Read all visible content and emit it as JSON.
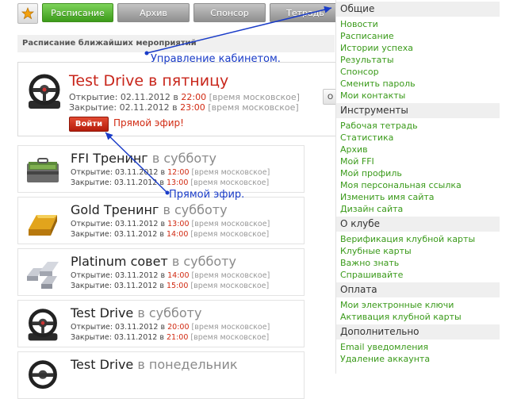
{
  "tabs": [
    {
      "label": "Расписание",
      "active": true
    },
    {
      "label": "Архив",
      "active": false
    },
    {
      "label": "Спонсор",
      "active": false
    },
    {
      "label": "Тетрадь",
      "active": false
    }
  ],
  "favorites_icon": "star-icon",
  "heading": "Расписание ближайших мероприятий",
  "featured": {
    "title": "Test Drive в пятницу",
    "open_label": "Открытие: 02.11.2012 в",
    "open_time": "22:00",
    "close_label": "Закрытие: 02.11.2012 в",
    "close_time": "23:00",
    "tz_note": "[время московское]",
    "enter_button": "Войти",
    "live_text": "Прямой эфир!"
  },
  "events": [
    {
      "name": "FFI Тренинг",
      "day": "в субботу",
      "open_label": "Открытие: 03.11.2012 в",
      "open_time": "12:00",
      "close_label": "Закрытие: 03.11.2012 в",
      "close_time": "13:00",
      "tz_note": "[время московское]",
      "icon": "cash-case-icon"
    },
    {
      "name": "Gold Тренинг",
      "day": "в субботу",
      "open_label": "Открытие: 03.11.2012 в",
      "open_time": "13:00",
      "close_label": "Закрытие: 03.11.2012 в",
      "close_time": "14:00",
      "tz_note": "[время московское]",
      "icon": "gold-bar-icon"
    },
    {
      "name": "Platinum совет",
      "day": "в субботу",
      "open_label": "Открытие: 03.11.2012 в",
      "open_time": "14:00",
      "close_label": "Закрытие: 03.11.2012 в",
      "close_time": "15:00",
      "tz_note": "[время московское]",
      "icon": "platinum-bars-icon"
    },
    {
      "name": "Test Drive",
      "day": "в субботу",
      "open_label": "Открытие: 03.11.2012 в",
      "open_time": "20:00",
      "close_label": "Закрытие: 03.11.2012 в",
      "close_time": "21:00",
      "tz_note": "[время московское]",
      "icon": "steering-wheel-icon"
    },
    {
      "name": "Test Drive",
      "day": "в понедельник",
      "icon": "steering-wheel-icon"
    }
  ],
  "sidebar": {
    "sections": [
      {
        "title": "Общие",
        "items": [
          "Новости",
          "Расписание",
          "Истории успеха",
          "Результаты",
          "Спонсор",
          "Сменить пароль",
          "Мои контакты"
        ]
      },
      {
        "title": "Инструменты",
        "items": [
          "Рабочая тетрадь",
          "Статистика",
          "Архив",
          "Мой FFI",
          "Мой профиль",
          "Моя персональная ссылка",
          "Изменить имя сайта",
          "Дизайн сайта"
        ]
      },
      {
        "title": "О клубе",
        "items": [
          "Верификация клубной карты",
          "Клубные карты",
          "Важно знать",
          "Спрашивайте"
        ]
      },
      {
        "title": "Оплата",
        "items": [
          "Мои электронные ключи",
          "Активация клубной карты"
        ]
      },
      {
        "title": "Дополнительно",
        "items": [
          "Email уведомления",
          "Удаление аккаунта"
        ]
      }
    ]
  },
  "annotations": {
    "cabinet": "Управление кабинетом.",
    "live": "Прямой эфир."
  },
  "colors": {
    "accent_green": "#3c9b1a",
    "link_green": "#3a9a1a",
    "alert_red": "#d12a12",
    "annotation_blue": "#1a3cc8"
  }
}
